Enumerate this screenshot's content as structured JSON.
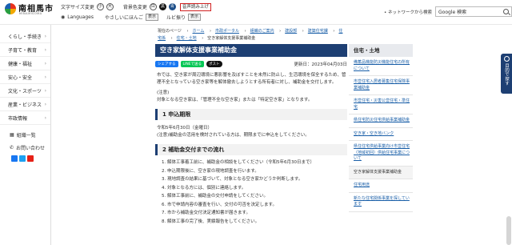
{
  "header": {
    "logo_text": "南相馬市",
    "logo_sub": "MINAMISOMA",
    "font_size_label": "文字サイズ変更",
    "font_small": "小",
    "font_large": "大",
    "bg_color_label": "背景色変更",
    "bg_options": [
      "白",
      "黒",
      "青"
    ],
    "voice_label": "音声読み上げ",
    "languages_label": "Languages",
    "easy_japanese": "やさしいにほんご",
    "show1": "表示",
    "ruby_label": "ルビ振り",
    "show2": "表示",
    "network_search": "ネットワークから検索",
    "search_brand": "Google 検索"
  },
  "sidebar": {
    "items": [
      {
        "label": "くらし・手続き"
      },
      {
        "label": "子育て・教育"
      },
      {
        "label": "健康・福祉"
      },
      {
        "label": "安心・安全"
      },
      {
        "label": "文化・スポーツ"
      },
      {
        "label": "産業・ビジネス"
      },
      {
        "label": "市政情報"
      }
    ],
    "org_list": "組織一覧",
    "contact": "お問い合わせ"
  },
  "breadcrumb": {
    "current_label": "現在のページ",
    "items": [
      "ホーム",
      "市政ポータル",
      "組織のご案内",
      "建設部",
      "建築住宅課",
      "住宅係",
      "住宅・土地",
      "空き家解体支援事業補助金"
    ]
  },
  "main": {
    "title": "空き家解体支援事業補助金",
    "share": {
      "facebook": "シェアする",
      "line": "LINEで送る",
      "x": "ポスト"
    },
    "updated": "更新日：2023年04月03日",
    "intro": "市では、空き家が周辺環境に悪影響を及ぼすことを未然に防止し、生活環境を保全するため、管理不全となっている空き家等を解体撤去しようとする所有者に対し、補助金を交付します。",
    "note_label": "(注意)",
    "note_text": "対象となる空き家は、「管理不全な空き家」または「特定空き家」となります。",
    "section1_title": "1 申込期限",
    "deadline": "令和5年6月30日（金曜日）",
    "deadline_note": "(注意)補助金の活用を検討されている方は、期限までに申込をしてください。",
    "section2_title": "2 補助金交付までの流れ",
    "steps": [
      "1. 解体工事着工前に、補助金の相談をしてください（令和5年6月30日まで）",
      "2. 申込期限後に、空き家の現地調査を行います。",
      "3. 現地調査の結果に基づいて、対象となる空き家かどうか判断します。",
      "4. 対象となる方には、個別に連絡します。",
      "5. 解体工事前に、補助金の交付申請をしてください。",
      "6. 市で申請内容の審査を行い、交付の可否を決定します。",
      "7. 市から補助金交付決定通知書が届きます。",
      "8. 解体工事の完了後、実績報告をしてください。"
    ]
  },
  "right": {
    "heading": "住宅・土地",
    "links": [
      "備蓄品機能防災機能住宅の所有について",
      "市営住宅入居者募集住宅保険事業補助金",
      "市営住宅・災害公営住宅・準住宅",
      "県住宅防災住宅供給事業補助金",
      "空き家・空き地バンク",
      "県住住宅供給事業向け市営住宅（地域初回）供給住宅事業について",
      "空き家解体支援事業補助金",
      "住宅用途",
      "新たな住宅関係事業を探しています"
    ],
    "current_index": 6
  },
  "float_button": "目的で探す",
  "colors": {
    "accent": "#1d3f73",
    "link": "#1a5fa8"
  }
}
